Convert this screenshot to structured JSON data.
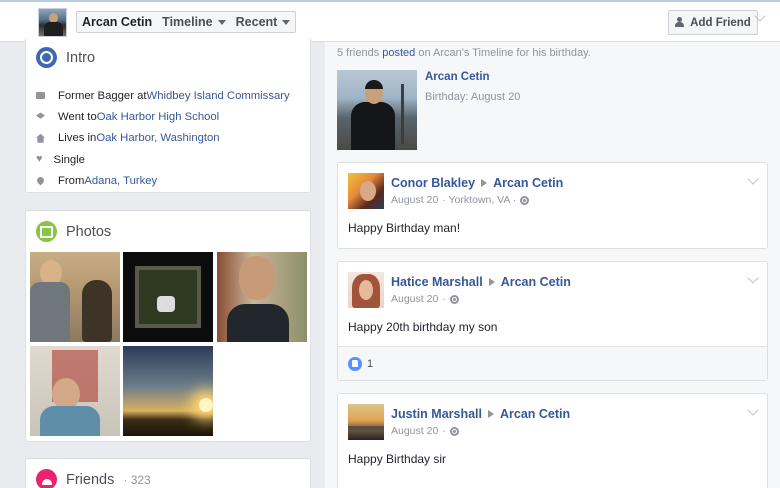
{
  "header": {
    "profile_name": "Arcan Cetin",
    "nav_timeline": "Timeline",
    "nav_recent": "Recent",
    "add_friend_label": "Add Friend"
  },
  "intro": {
    "title": "Intro",
    "items": [
      {
        "icon": "briefcase-icon",
        "prefix": "Former Bagger at ",
        "link": "Whidbey Island Commissary",
        "suffix": ""
      },
      {
        "icon": "graduation-cap-icon",
        "prefix": "Went to ",
        "link": "Oak Harbor High School",
        "suffix": ""
      },
      {
        "icon": "home-icon",
        "prefix": "Lives in ",
        "link": "Oak Harbor, Washington",
        "suffix": ""
      },
      {
        "icon": "heart-icon",
        "prefix": "Single",
        "link": "",
        "suffix": ""
      },
      {
        "icon": "location-pin-icon",
        "prefix": "From ",
        "link": "Adana, Turkey",
        "suffix": ""
      }
    ]
  },
  "photos": {
    "title": "Photos"
  },
  "friends": {
    "title": "Friends",
    "count": "· 323"
  },
  "birthday_summary": {
    "prefix": "5 friends ",
    "link": "posted",
    "suffix": " on Arcan's Timeline for his birthday.",
    "name": "Arcan Cetin",
    "birthday": "Birthday: August 20"
  },
  "posts": [
    {
      "author": "Conor Blakley",
      "target": "Arcan Cetin",
      "date": "August 20",
      "location": " · Yorktown, VA · ",
      "text": "Happy Birthday man!",
      "likes": ""
    },
    {
      "author": "Hatice Marshall",
      "target": "Arcan Cetin",
      "date": "August 20",
      "location": " · ",
      "text": "Happy 20th birthday my son",
      "likes": "1"
    },
    {
      "author": "Justin Marshall",
      "target": "Arcan Cetin",
      "date": "August 20",
      "location": " · ",
      "text": "Happy Birthday sir",
      "likes": ""
    }
  ],
  "colors": {
    "link": "#365899",
    "header_bg": "#ffffff",
    "page_bg": "#e9ebee",
    "like_blue": "#5890ff",
    "photos_green": "#88c540",
    "friends_pink": "#e9236d",
    "intro_blue": "#4267b2"
  }
}
